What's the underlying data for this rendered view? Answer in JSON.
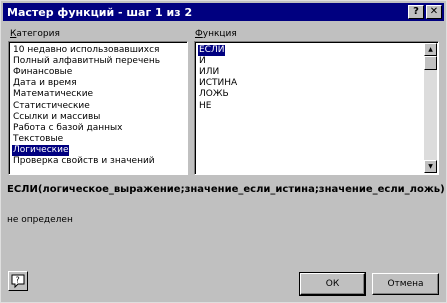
{
  "window": {
    "title": "Мастер функций - шаг 1 из 2",
    "help_glyph": "?",
    "close_glyph": "✕"
  },
  "category": {
    "label_first": "К",
    "label_rest": "атегория",
    "items": [
      "10 недавно использовавшихся",
      "Полный алфавитный перечень",
      "Финансовые",
      "Дата и время",
      "Математические",
      "Статистические",
      "Ссылки и массивы",
      "Работа с базой данных",
      "Текстовые",
      "Логические",
      "Проверка свойств и значений"
    ],
    "selected": "Логические"
  },
  "function": {
    "label_first": "Ф",
    "label_rest": "ункция",
    "items": [
      "ЕСЛИ",
      "И",
      "ИЛИ",
      "ИСТИНА",
      "ЛОЖЬ",
      "НЕ"
    ],
    "selected": "ЕСЛИ"
  },
  "syntax": "ЕСЛИ(логическое_выражение;значение_если_истина;значение_если_ложь)",
  "description": "не определен",
  "buttons": {
    "ok": "ОК",
    "cancel": "Отмена"
  },
  "colors": {
    "selection": "#000080",
    "face": "#c0c0c0",
    "titlebar": "#000080"
  },
  "icons": {
    "help_assistant": "help-assistant-icon",
    "scroll_up": "scroll-up-arrow-icon",
    "scroll_down": "scroll-down-arrow-icon"
  }
}
